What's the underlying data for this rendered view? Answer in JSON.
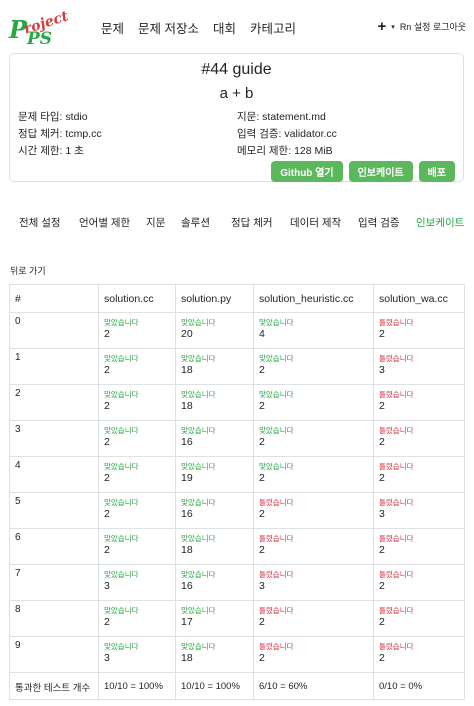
{
  "nav": {
    "logo_text": "Project PS",
    "links": [
      "문제",
      "문제 저장소",
      "대회",
      "카테고리"
    ],
    "plus": "+",
    "caret": "▾",
    "right_text": "Rn 설정 로그아웃"
  },
  "problem": {
    "title": "#44 guide",
    "subtitle": "a + b",
    "type_label": "문제 타입:",
    "type_value": "stdio",
    "checker_label": "정답 체커:",
    "checker_value": "tcmp.cc",
    "time_label": "시간 제한:",
    "time_value": "1 초",
    "statement_label": "지문:",
    "statement_value": "statement.md",
    "validator_label": "입력 검증:",
    "validator_value": "validator.cc",
    "memory_label": "메모리 제한:",
    "memory_value": "128 MiB",
    "buttons": [
      "Github 열기",
      "인보케이트",
      "배포"
    ]
  },
  "tabs": [
    "전체 설정",
    "언어별 제한",
    "지문",
    "솔루션",
    "정답 체커",
    "데이터 제작",
    "입력 검증",
    "인보케이트"
  ],
  "back_label": "뒤로 가기",
  "table": {
    "headers": [
      "#",
      "solution.cc",
      "solution.py",
      "solution_heuristic.cc",
      "solution_wa.cc"
    ],
    "rows": [
      {
        "id": "0",
        "cells": [
          {
            "status": "맞았습니다",
            "ok": true,
            "value": "2"
          },
          {
            "status": "맞았습니다",
            "ok": true,
            "value": "20"
          },
          {
            "status": "맞았습니다",
            "ok": true,
            "value": "4"
          },
          {
            "status": "틀렸습니다",
            "ok": false,
            "value": "2"
          }
        ]
      },
      {
        "id": "1",
        "cells": [
          {
            "status": "맞았습니다",
            "ok": true,
            "value": "2"
          },
          {
            "status": "맞았습니다",
            "ok": true,
            "value": "18"
          },
          {
            "status": "맞았습니다",
            "ok": true,
            "value": "2"
          },
          {
            "status": "틀렸습니다",
            "ok": false,
            "value": "3"
          }
        ]
      },
      {
        "id": "2",
        "cells": [
          {
            "status": "맞았습니다",
            "ok": true,
            "value": "2"
          },
          {
            "status": "맞았습니다",
            "ok": true,
            "value": "18"
          },
          {
            "status": "맞았습니다",
            "ok": true,
            "value": "2"
          },
          {
            "status": "틀렸습니다",
            "ok": false,
            "value": "2"
          }
        ]
      },
      {
        "id": "3",
        "cells": [
          {
            "status": "맞았습니다",
            "ok": true,
            "value": "2"
          },
          {
            "status": "맞았습니다",
            "ok": true,
            "value": "16"
          },
          {
            "status": "맞았습니다",
            "ok": true,
            "value": "2"
          },
          {
            "status": "틀렸습니다",
            "ok": false,
            "value": "2"
          }
        ]
      },
      {
        "id": "4",
        "cells": [
          {
            "status": "맞았습니다",
            "ok": true,
            "value": "2"
          },
          {
            "status": "맞았습니다",
            "ok": true,
            "value": "19"
          },
          {
            "status": "맞았습니다",
            "ok": true,
            "value": "2"
          },
          {
            "status": "틀렸습니다",
            "ok": false,
            "value": "2"
          }
        ]
      },
      {
        "id": "5",
        "cells": [
          {
            "status": "맞았습니다",
            "ok": true,
            "value": "2"
          },
          {
            "status": "맞았습니다",
            "ok": true,
            "value": "16"
          },
          {
            "status": "틀렸습니다",
            "ok": false,
            "value": "2"
          },
          {
            "status": "틀렸습니다",
            "ok": false,
            "value": "3"
          }
        ]
      },
      {
        "id": "6",
        "cells": [
          {
            "status": "맞았습니다",
            "ok": true,
            "value": "2"
          },
          {
            "status": "맞았습니다",
            "ok": true,
            "value": "18"
          },
          {
            "status": "틀렸습니다",
            "ok": false,
            "value": "2"
          },
          {
            "status": "틀렸습니다",
            "ok": false,
            "value": "2"
          }
        ]
      },
      {
        "id": "7",
        "cells": [
          {
            "status": "맞았습니다",
            "ok": true,
            "value": "3"
          },
          {
            "status": "맞았습니다",
            "ok": true,
            "value": "16"
          },
          {
            "status": "틀렸습니다",
            "ok": false,
            "value": "3"
          },
          {
            "status": "틀렸습니다",
            "ok": false,
            "value": "2"
          }
        ]
      },
      {
        "id": "8",
        "cells": [
          {
            "status": "맞았습니다",
            "ok": true,
            "value": "2"
          },
          {
            "status": "맞았습니다",
            "ok": true,
            "value": "17"
          },
          {
            "status": "틀렸습니다",
            "ok": false,
            "value": "2"
          },
          {
            "status": "틀렸습니다",
            "ok": false,
            "value": "2"
          }
        ]
      },
      {
        "id": "9",
        "cells": [
          {
            "status": "맞았습니다",
            "ok": true,
            "value": "3"
          },
          {
            "status": "맞았습니다",
            "ok": true,
            "value": "18"
          },
          {
            "status": "틀렸습니다",
            "ok": false,
            "value": "2"
          },
          {
            "status": "틀렸습니다",
            "ok": false,
            "value": "2"
          }
        ]
      }
    ],
    "footer_label": "통과한 테스트 개수",
    "footer_values": [
      "10/10 = 100%",
      "10/10 = 100%",
      "6/10 = 60%",
      "0/10 = 0%"
    ]
  },
  "colors": {
    "accent": "#5cb85c",
    "ok": "#28a745",
    "bad": "#dc3545"
  }
}
